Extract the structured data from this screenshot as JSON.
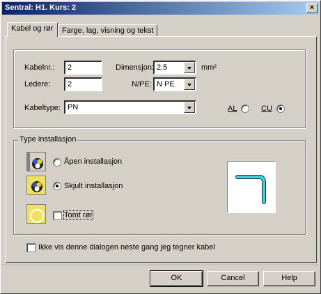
{
  "window": {
    "title": "Sentral: H1. Kurs: 2",
    "close_glyph": "×"
  },
  "tabs": [
    {
      "label": "Kabel og rør",
      "active": true
    },
    {
      "label": "Farge, lag, visning og tekst",
      "active": false
    }
  ],
  "cable": {
    "kabelnr_label": "Kabelnr.:",
    "kabelnr_value": "2",
    "ledere_label": "Ledere:",
    "ledere_value": "2",
    "dimensjon_label": "Dimensjon:",
    "dimensjon_value": "2.5",
    "dimensjon_unit": "mm²",
    "npe_label": "N/PE:",
    "npe_value": "N PE",
    "kabeltype_label": "Kabeltype:",
    "kabeltype_value": "PN",
    "al_label": "AL",
    "cu_label": "CU",
    "material_selected": "CU"
  },
  "installation": {
    "group_label": "Type installasjon",
    "open_label": "Åpen installasjon",
    "hidden_label": "Skjult installasjon",
    "selected": "hidden",
    "tomt_ror_label": "Tomt rør",
    "tomt_ror_checked": false
  },
  "dont_show_label": "Ikke vis denne dialogen neste gang jeg tegner kabel",
  "dont_show_checked": false,
  "buttons": {
    "ok": "OK",
    "cancel": "Cancel",
    "help": "Help"
  },
  "colors": {
    "titlebar_start": "#0a246a",
    "titlebar_end": "#a6caf0",
    "preview_pipe": "#40d0d8"
  }
}
